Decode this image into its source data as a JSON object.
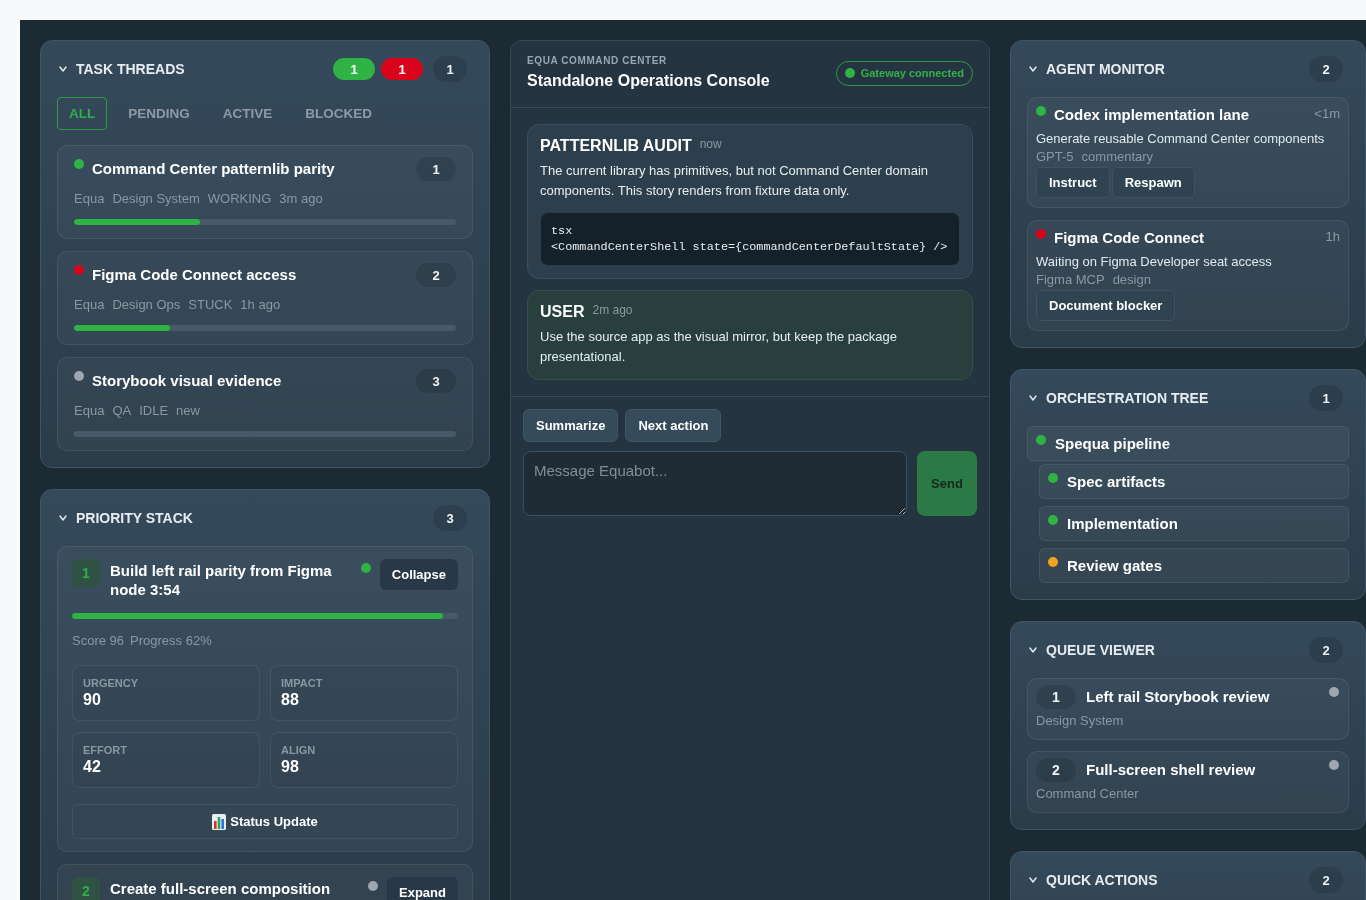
{
  "left_panels": [
    {
      "kind": "threads",
      "title": "TASK THREADS",
      "expanded": true,
      "status_counts": [
        {
          "label": "1",
          "color": "#2fb344"
        },
        {
          "label": "1",
          "color": "#d9041c"
        }
      ],
      "count": "1",
      "filters": [
        {
          "label": "ALL",
          "selected": true
        },
        {
          "label": "PENDING",
          "selected": false
        },
        {
          "label": "ACTIVE",
          "selected": false
        },
        {
          "label": "BLOCKED",
          "selected": false
        }
      ],
      "threads": [
        {
          "title": "Command Center patternlib parity",
          "color": "#2fb344",
          "badge": "1",
          "meta": [
            "Equa",
            "Design System",
            "WORKING",
            "3m ago"
          ],
          "level": 0.33
        },
        {
          "title": "Figma Code Connect access",
          "color": "#d9041c",
          "badge": "2",
          "meta": [
            "Equa",
            "Design Ops",
            "STUCK",
            "1h ago"
          ],
          "level": 0.25
        },
        {
          "title": "Storybook visual evidence",
          "color": "#9ea7b0",
          "badge": "3",
          "meta": [
            "Equa",
            "QA",
            "IDLE",
            "new"
          ],
          "level": 0
        }
      ]
    },
    {
      "kind": "priority",
      "title": "PRIORITY STACK",
      "expanded": true,
      "count": "3",
      "items": [
        {
          "rank": "1",
          "title": "Build left rail parity from Figma node 3:54",
          "color": "#2fb344",
          "expanded": true,
          "toggle": "Collapse",
          "level": 0.96,
          "summary": [
            "Score 96",
            "Progress 62%"
          ],
          "metrics": [
            {
              "label": "URGENCY",
              "value": "90"
            },
            {
              "label": "IMPACT",
              "value": "88"
            },
            {
              "label": "EFFORT",
              "value": "42"
            },
            {
              "label": "ALIGN",
              "value": "98"
            }
          ],
          "action": "Status Update"
        },
        {
          "rank": "2",
          "title": "Create full-screen composition",
          "color": "#9ea7b0",
          "expanded": false,
          "toggle": "Expand"
        }
      ]
    }
  ],
  "console": {
    "eyebrow": "EQUA COMMAND CENTER",
    "title": "Standalone Operations Console",
    "connection": {
      "label": "Gateway connected",
      "connected": true
    },
    "messages": [
      {
        "kind": "system",
        "author": "PATTERNLIB AUDIT",
        "time": "now",
        "body": "The current library has primitives, but not Command Center domain components. This story renders from fixture data only.",
        "code": {
          "language": "tsx",
          "text": "<CommandCenterShell state={commandCenterDefaultState} />"
        }
      },
      {
        "kind": "user",
        "author": "USER",
        "time": "2m ago",
        "body": "Use the source app as the visual mirror, but keep the package presentational."
      }
    ],
    "quick_prompts": [
      "Summarize",
      "Next action"
    ],
    "composer": {
      "placeholder": "Message Equabot..."
    },
    "send_label": "Send"
  },
  "right_panels": [
    {
      "kind": "agents",
      "title": "AGENT MONITOR",
      "expanded": true,
      "count": "2",
      "agents": [
        {
          "name": "Codex implementation lane",
          "color": "#2fb344",
          "time": "<1m",
          "task": "Generate reusable Command Center components",
          "meta": [
            "GPT-5",
            "commentary"
          ],
          "actions": [
            "Instruct",
            "Respawn"
          ]
        },
        {
          "name": "Figma Code Connect",
          "color": "#d9041c",
          "time": "1h",
          "task": "Waiting on Figma Developer seat access",
          "meta": [
            "Figma MCP",
            "design"
          ],
          "actions": [
            "Document blocker"
          ]
        }
      ]
    },
    {
      "kind": "tree",
      "title": "ORCHESTRATION TREE",
      "expanded": true,
      "count": "1",
      "nodes": [
        {
          "label": "Spequa pipeline",
          "color": "#2fb344",
          "children": [
            {
              "label": "Spec artifacts",
              "color": "#2fb344"
            },
            {
              "label": "Implementation",
              "color": "#2fb344"
            },
            {
              "label": "Review gates",
              "color": "#f2a324"
            }
          ]
        }
      ]
    },
    {
      "kind": "queue",
      "title": "QUEUE VIEWER",
      "expanded": true,
      "count": "2",
      "items": [
        {
          "rank": "1",
          "title": "Left rail Storybook review",
          "subtitle": "Design System",
          "color": "#9ea7b0"
        },
        {
          "rank": "2",
          "title": "Full-screen shell review",
          "subtitle": "Command Center",
          "color": "#9ea7b0"
        }
      ]
    },
    {
      "kind": "actions",
      "title": "QUICK ACTIONS",
      "expanded": true,
      "count": "2"
    }
  ]
}
